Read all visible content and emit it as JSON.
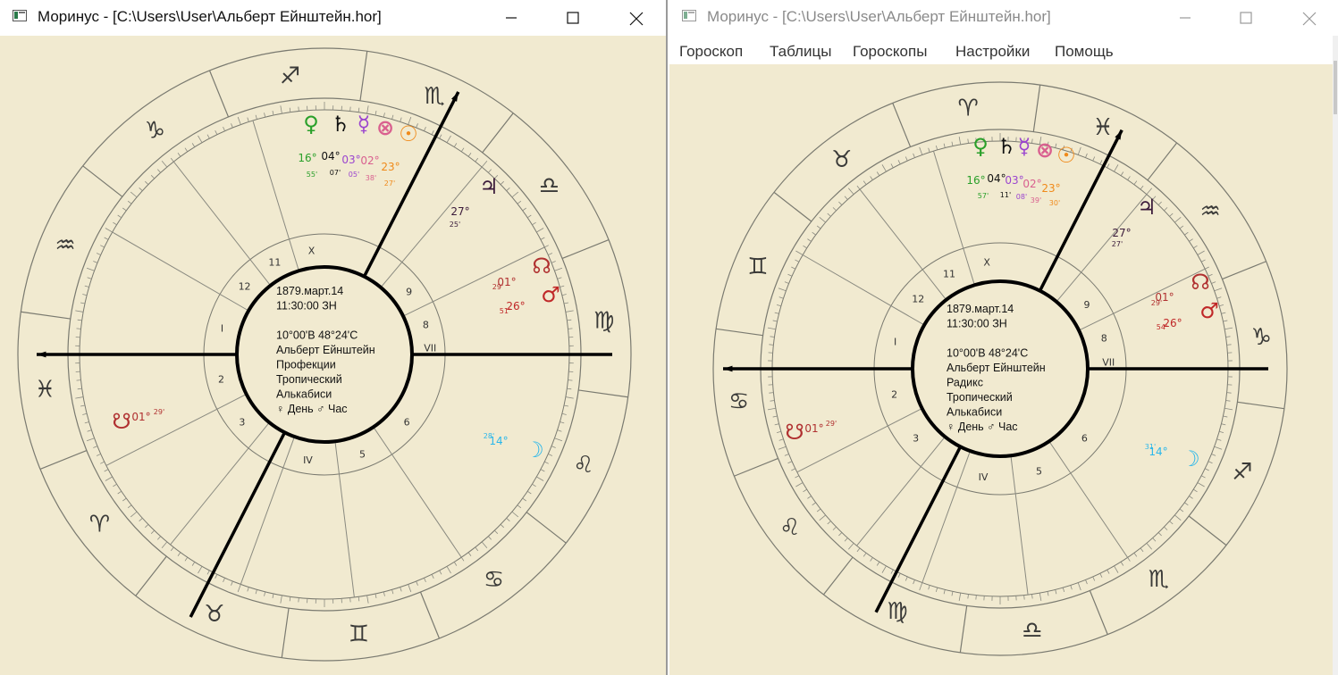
{
  "windows": [
    {
      "title": "Моринус - [C:\\Users\\User\\Альберт Ейнштейн.hor]",
      "active": true,
      "menu": [],
      "chart": {
        "info": [
          "1879.март.14",
          "11:30:00 ЗН",
          "",
          "10°00'В  48°24'С",
          "Альберт Ейнштейн",
          "Профекции",
          "Тропический",
          "Алькабиси",
          "♀ День  ♂ Час"
        ],
        "houses": [
          "X",
          "11",
          "12",
          "I",
          "2",
          "3",
          "IV",
          "5",
          "6",
          "VII",
          "8",
          "9"
        ],
        "sign_glyphs": [
          "♐",
          "♏",
          "♎",
          "♍",
          "♌",
          "♋",
          "♊",
          "♉",
          "♈",
          "♓",
          "♒",
          "♑"
        ],
        "planets": [
          {
            "glyph": "♀",
            "deg": "16°",
            "min": "55'",
            "color": "#2aa02a"
          },
          {
            "glyph": "♄",
            "deg": "04°",
            "min": "07'",
            "color": "#111111"
          },
          {
            "glyph": "☿",
            "deg": "03°",
            "min": "05'",
            "color": "#9b45cf"
          },
          {
            "glyph": "⊗",
            "deg": "02°",
            "min": "38'",
            "color": "#d9608f"
          },
          {
            "glyph": "☉",
            "deg": "23°",
            "min": "27'",
            "color": "#f08a1a"
          },
          {
            "glyph": "♃",
            "deg": "27°",
            "min": "25'",
            "color": "#3a1a3a"
          },
          {
            "glyph": "☊",
            "deg": "01°",
            "min": "29'",
            "color": "#b03030"
          },
          {
            "glyph": "♂",
            "deg": "26°",
            "min": "51'",
            "color": "#c02828"
          },
          {
            "glyph": "☽",
            "deg": "14°",
            "min": "28'",
            "color": "#2ab7ea"
          },
          {
            "glyph": "☋",
            "deg": "01°",
            "min": "29'",
            "color": "#b03030"
          }
        ]
      }
    },
    {
      "title": "Моринус - [C:\\Users\\User\\Альберт Ейнштейн.hor]",
      "active": false,
      "menu": [
        "Гороскоп",
        "Таблицы",
        "Гороскопы",
        "Настройки",
        "Помощь"
      ],
      "chart": {
        "info": [
          "1879.март.14",
          "11:30:00 ЗН",
          "",
          "10°00'В  48°24'С",
          "Альберт Ейнштейн",
          "Радикс",
          "Тропический",
          "Алькабиси",
          "♀ День  ♂ Час"
        ],
        "houses": [
          "X",
          "11",
          "12",
          "I",
          "2",
          "3",
          "IV",
          "5",
          "6",
          "VII",
          "8",
          "9"
        ],
        "sign_glyphs": [
          "♈",
          "♓",
          "♒",
          "♑",
          "♐",
          "♏",
          "♎",
          "♍",
          "♌",
          "♋",
          "♊",
          "♉"
        ],
        "planets": [
          {
            "glyph": "♀",
            "deg": "16°",
            "min": "57'",
            "color": "#2aa02a"
          },
          {
            "glyph": "♄",
            "deg": "04°",
            "min": "11'",
            "color": "#111111"
          },
          {
            "glyph": "☿",
            "deg": "03°",
            "min": "08'",
            "color": "#9b45cf"
          },
          {
            "glyph": "⊗",
            "deg": "02°",
            "min": "39'",
            "color": "#d9608f"
          },
          {
            "glyph": "☉",
            "deg": "23°",
            "min": "30'",
            "color": "#f08a1a"
          },
          {
            "glyph": "♃",
            "deg": "27°",
            "min": "27'",
            "color": "#3a1a3a"
          },
          {
            "glyph": "☊",
            "deg": "01°",
            "min": "29'",
            "color": "#b03030"
          },
          {
            "glyph": "♂",
            "deg": "26°",
            "min": "54'",
            "color": "#c02828"
          },
          {
            "glyph": "☽",
            "deg": "14°",
            "min": "31'",
            "color": "#2ab7ea"
          },
          {
            "glyph": "☋",
            "deg": "01°",
            "min": "29'",
            "color": "#b03030"
          }
        ]
      }
    }
  ]
}
